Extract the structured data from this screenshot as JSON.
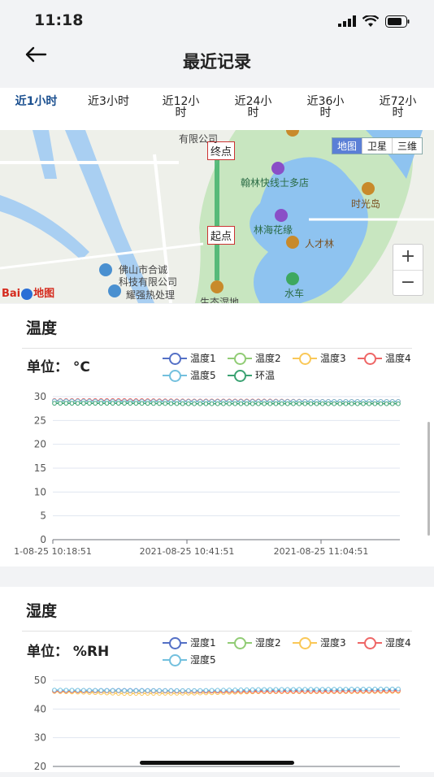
{
  "status": {
    "time": "11:18"
  },
  "nav": {
    "title": "最近记录"
  },
  "tabs": [
    {
      "label": "近1小时",
      "active": true
    },
    {
      "label": "近3小时",
      "active": false
    },
    {
      "label": "近12小时",
      "active": false
    },
    {
      "label": "近24小时",
      "active": false
    },
    {
      "label": "近36小时",
      "active": false
    },
    {
      "label": "近72小时",
      "active": false
    }
  ],
  "map": {
    "type_buttons": [
      "地图",
      "卫星",
      "三维"
    ],
    "end_label": "终点",
    "start_label": "起点",
    "logo_text": "Bai",
    "logo_text2": "地图",
    "places": {
      "p1": "有限公司",
      "p2": "翰林快线士多店",
      "p3": "时光岛",
      "p4": "林海花缘",
      "p5": "人才林",
      "p6": "佛山市合诚",
      "p7": "科技有限公司",
      "p8": "耀强热处理",
      "p9": "水车",
      "p10": "生态湿地"
    },
    "zoom_in": "+",
    "zoom_out": "−"
  },
  "temperature": {
    "title": "温度",
    "unit": "单位： °C",
    "legend": [
      {
        "name": "温度1",
        "color": "#5470c6"
      },
      {
        "name": "温度2",
        "color": "#91cc75"
      },
      {
        "name": "温度3",
        "color": "#fac858"
      },
      {
        "name": "温度4",
        "color": "#ee6666"
      },
      {
        "name": "温度5",
        "color": "#73c0de"
      },
      {
        "name": "环温",
        "color": "#3ba272"
      }
    ]
  },
  "humidity": {
    "title": "湿度",
    "unit": "单位： %RH",
    "legend": [
      {
        "name": "湿度1",
        "color": "#5470c6"
      },
      {
        "name": "湿度2",
        "color": "#91cc75"
      },
      {
        "name": "湿度3",
        "color": "#fac858"
      },
      {
        "name": "湿度4",
        "color": "#ee6666"
      },
      {
        "name": "湿度5",
        "color": "#73c0de"
      }
    ]
  },
  "chart_data": [
    {
      "type": "line",
      "title": "温度",
      "ylim": [
        0,
        30
      ],
      "y_ticks": [
        0,
        5,
        10,
        15,
        20,
        25,
        30
      ],
      "x_tick_labels": [
        "1-08-25 10:18:51",
        "2021-08-25 10:41:51",
        "2021-08-25 11:04:51"
      ],
      "series": [
        {
          "name": "温度1",
          "values": [
            29.1,
            29.1,
            29.0,
            29.0,
            29.0,
            29.0
          ]
        },
        {
          "name": "温度2",
          "values": [
            29.0,
            29.0,
            29.0,
            28.9,
            28.9,
            28.9
          ]
        },
        {
          "name": "温度3",
          "values": [
            29.1,
            29.0,
            29.0,
            29.0,
            29.0,
            29.0
          ]
        },
        {
          "name": "温度4",
          "values": [
            29.2,
            29.2,
            29.1,
            29.1,
            29.0,
            29.0
          ]
        },
        {
          "name": "温度5",
          "values": [
            29.1,
            29.0,
            29.0,
            29.0,
            29.0,
            29.0
          ]
        },
        {
          "name": "环温",
          "values": [
            28.6,
            28.6,
            28.5,
            28.5,
            28.5,
            28.5
          ]
        }
      ]
    },
    {
      "type": "line",
      "title": "湿度",
      "ylim": [
        20,
        50
      ],
      "y_ticks": [
        20,
        30,
        40,
        50
      ],
      "series": [
        {
          "name": "湿度1",
          "values": [
            46.5,
            46.5,
            46.4,
            46.5,
            46.6,
            46.7
          ]
        },
        {
          "name": "湿度2",
          "values": [
            46.2,
            46.2,
            46.2,
            46.3,
            46.3,
            46.4
          ]
        },
        {
          "name": "湿度3",
          "values": [
            46.1,
            45.4,
            45.5,
            46.0,
            46.0,
            46.1
          ]
        },
        {
          "name": "湿度4",
          "values": [
            46.3,
            46.3,
            46.2,
            46.2,
            46.2,
            46.4
          ]
        },
        {
          "name": "湿度5",
          "values": [
            46.6,
            46.4,
            46.4,
            46.8,
            46.9,
            47.0
          ]
        }
      ]
    }
  ]
}
